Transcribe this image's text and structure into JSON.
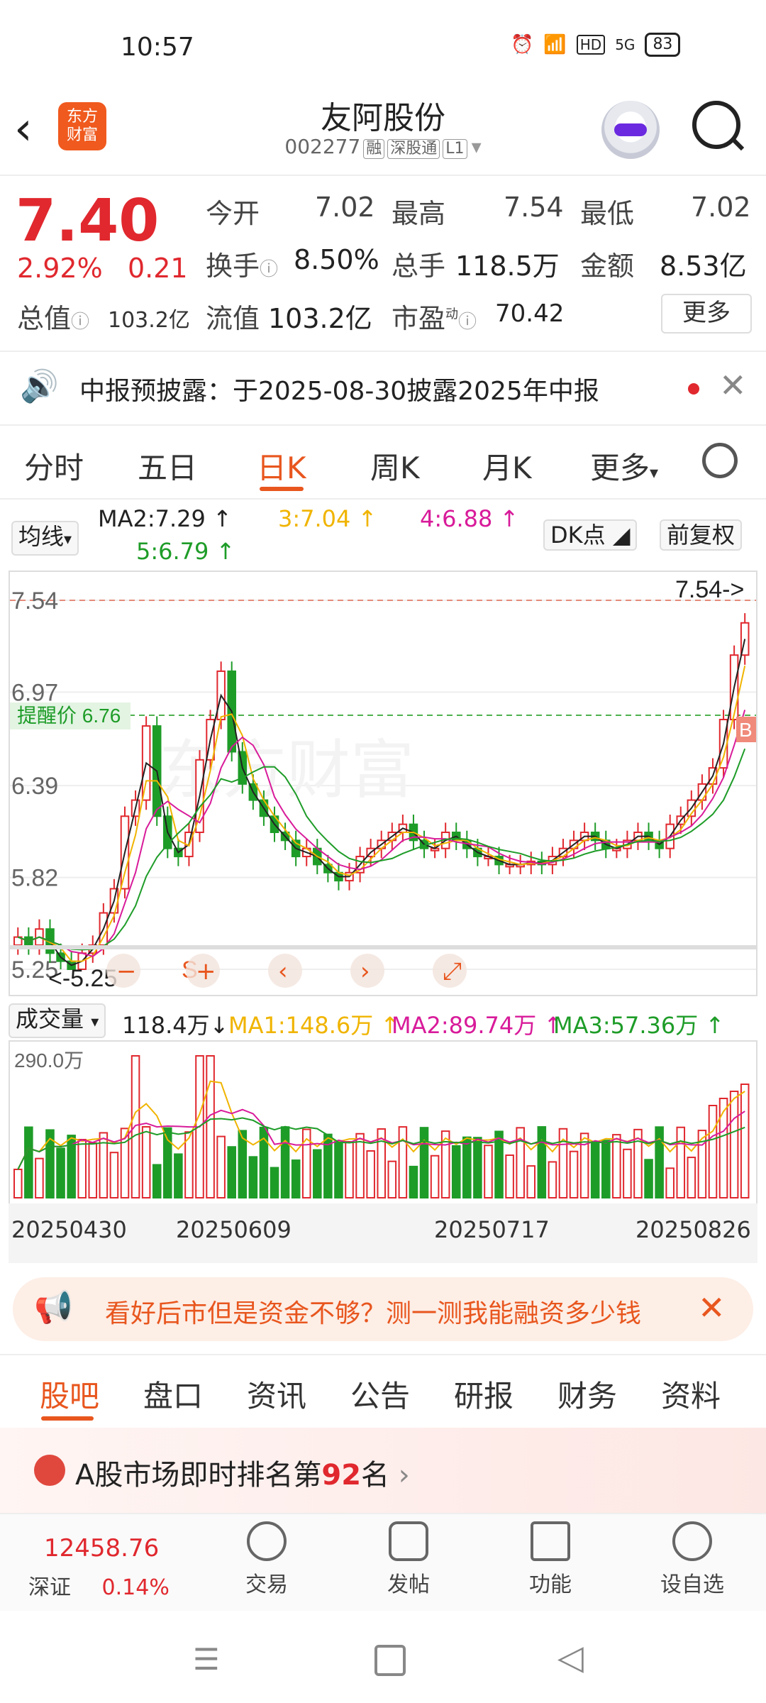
{
  "status": {
    "time": "10:57",
    "battery": "83",
    "network": "5G",
    "hd": "HD"
  },
  "header": {
    "back_label": "‹",
    "logo_text_1": "东方",
    "logo_text_2": "财富",
    "stock_name": "友阿股份",
    "stock_code": "002277",
    "tags": [
      "融",
      "深股通",
      "L1"
    ]
  },
  "quote": {
    "price": "7.40",
    "change_pct": "2.92%",
    "change": "0.21",
    "total_value_label": "总值",
    "total_value": "103.2亿",
    "open_label": "今开",
    "open": "7.02",
    "high_label": "最高",
    "high": "7.54",
    "low_label": "最低",
    "low": "7.02",
    "turnover_label": "换手",
    "turnover": "8.50%",
    "total_hands_label": "总手",
    "total_hands": "118.5万",
    "amount_label": "金额",
    "amount": "8.53亿",
    "float_value_label": "流值",
    "float_value": "103.2亿",
    "pe_label": "市盈",
    "pe_sup": "动",
    "pe": "70.42",
    "more_label": "更多"
  },
  "notice": {
    "text": "中报预披露：于2025-08-30披露2025年中报",
    "close": "✕"
  },
  "period_tabs": [
    "分时",
    "五日",
    "日K",
    "周K",
    "月K",
    "更多"
  ],
  "period_active": "日K",
  "ma_row": {
    "selector": "均线",
    "ma2": "MA2:7.29",
    "ma3": "3:7.04",
    "ma4": "4:6.88",
    "ma5": "5:6.79",
    "dk": "DK点",
    "adjust": "前复权"
  },
  "kline": {
    "y_labels": [
      "7.54",
      "6.97",
      "6.39",
      "5.82",
      "5.25"
    ],
    "high_marker": "7.54->",
    "low_marker": "<-5.25",
    "alert_label": "提醒价 6.76",
    "watermark": "东方财富",
    "tool_icons": [
      "minus-icon",
      "plus-icon",
      "left-icon",
      "right-icon",
      "fullscreen-icon"
    ],
    "markers": {
      "s": "S",
      "b": "B"
    }
  },
  "volume": {
    "selector": "成交量",
    "current": "118.4万",
    "ma1": "MA1:148.6万",
    "ma2": "MA2:89.74万",
    "ma3": "MA3:57.36万",
    "max_label": "290.0万"
  },
  "dates": [
    "20250430",
    "20250609",
    "20250717",
    "20250826"
  ],
  "promo": {
    "text": "看好后市但是资金不够？测一测我能融资多少钱"
  },
  "section_tabs": [
    "股吧",
    "盘口",
    "资讯",
    "公告",
    "研报",
    "财务",
    "资料"
  ],
  "section_active": "股吧",
  "rank": {
    "prefix": "A股市场即时排名第",
    "number": "92",
    "suffix": "名"
  },
  "bottom": {
    "index_value": "12458.76",
    "index_name": "深证",
    "index_pct": "0.14%",
    "items": [
      "交易",
      "发帖",
      "功能",
      "设自选"
    ]
  },
  "colors": {
    "accent": "#e8561e",
    "up": "#e0282e",
    "down": "#1e9c28",
    "ma2": "#222222",
    "ma3": "#f0b400",
    "ma4": "#d81b9a",
    "ma5": "#1e9c28"
  },
  "chart_data": {
    "type": "candlestick",
    "x_labels": [
      "20250430",
      "20250609",
      "20250717",
      "20250826"
    ],
    "ylim": [
      5.25,
      7.54
    ],
    "y_ticks": [
      7.54,
      6.97,
      6.39,
      5.82,
      5.25
    ],
    "candles_close_approx": [
      5.45,
      5.4,
      5.5,
      5.35,
      5.3,
      5.25,
      5.35,
      5.4,
      5.6,
      5.75,
      6.2,
      6.3,
      6.76,
      6.2,
      6.0,
      5.95,
      6.1,
      6.55,
      6.8,
      7.1,
      6.6,
      6.4,
      6.3,
      6.2,
      6.1,
      6.05,
      5.95,
      6.0,
      5.9,
      5.85,
      5.8,
      5.85,
      5.95,
      6.0,
      6.05,
      6.1,
      6.15,
      6.05,
      6.0,
      6.0,
      6.1,
      6.05,
      6.0,
      5.95,
      5.95,
      5.9,
      5.9,
      5.9,
      5.92,
      5.9,
      5.95,
      6.0,
      6.05,
      6.1,
      6.05,
      6.0,
      6.0,
      6.05,
      6.1,
      6.05,
      6.0,
      6.15,
      6.2,
      6.3,
      6.4,
      6.5,
      6.8,
      7.2,
      7.4
    ],
    "volume_max_label": "290.0万",
    "volume_current": "118.4万"
  }
}
